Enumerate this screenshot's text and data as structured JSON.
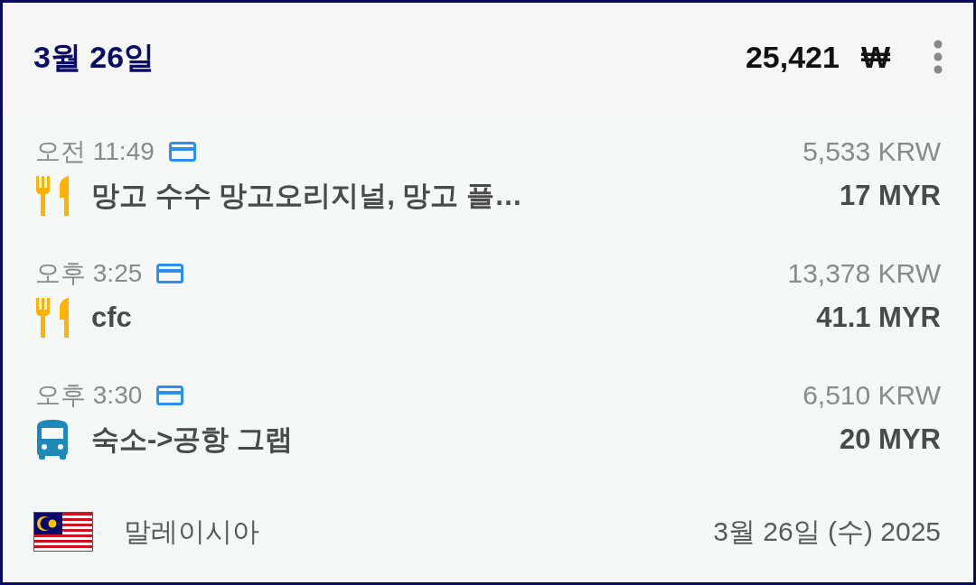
{
  "header": {
    "date": "3월 26일",
    "total": "25,421",
    "currency_symbol": "₩"
  },
  "entries": [
    {
      "time": "오전 11:49",
      "payment": {
        "kind": "card"
      },
      "kind": "food",
      "title": "망고 수수 망고오리지널, 망고 플…",
      "home_amount": "5,533 KRW",
      "amount": "17 MYR"
    },
    {
      "time": "오후 3:25",
      "payment": {
        "kind": "card"
      },
      "kind": "food",
      "title": "cfc",
      "home_amount": "13,378 KRW",
      "amount": "41.1 MYR"
    },
    {
      "time": "오후 3:30",
      "payment": {
        "kind": "card"
      },
      "kind": "bus",
      "title": "숙소->공항 그랩",
      "home_amount": "6,510 KRW",
      "amount": "20 MYR"
    }
  ],
  "footer": {
    "country": "말레이시아",
    "date": "3월 26일 (수) 2025"
  }
}
